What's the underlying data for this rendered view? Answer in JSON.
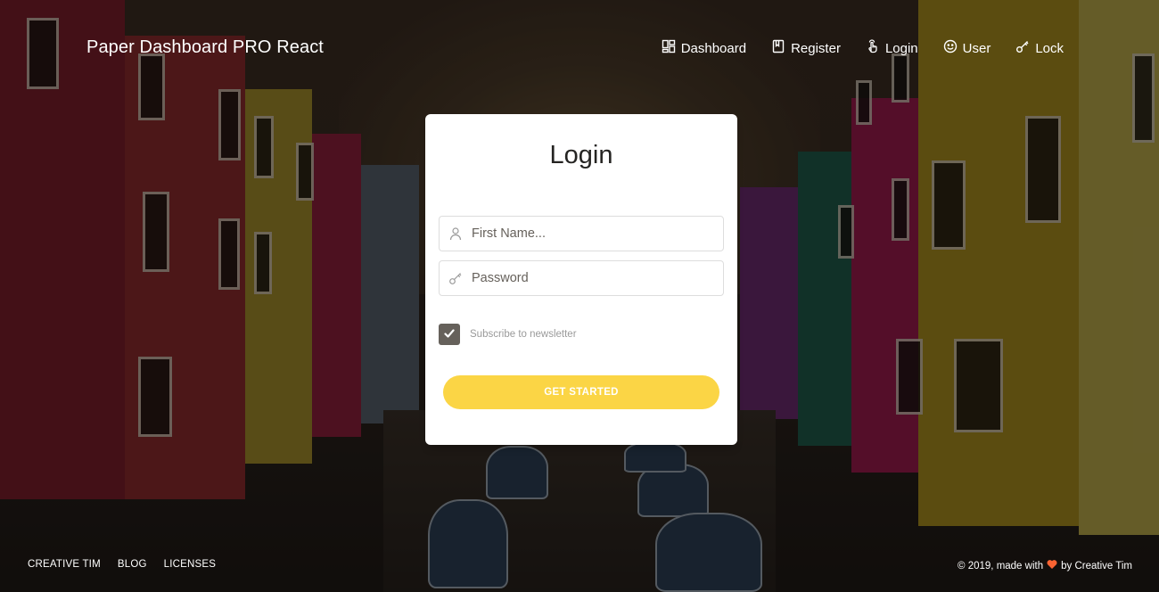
{
  "brand": {
    "title": "Paper Dashboard PRO React"
  },
  "nav": {
    "items": [
      {
        "label": "Dashboard",
        "icon": "layout-icon"
      },
      {
        "label": "Register",
        "icon": "book-icon"
      },
      {
        "label": "Login",
        "icon": "tap-hand-icon"
      },
      {
        "label": "User",
        "icon": "smiley-icon"
      },
      {
        "label": "Lock",
        "icon": "key-icon"
      }
    ]
  },
  "login": {
    "title": "Login",
    "first_name_placeholder": "First Name...",
    "password_placeholder": "Password",
    "newsletter_label": "Subscribe to newsletter",
    "newsletter_checked": true,
    "submit_label": "GET STARTED"
  },
  "footer": {
    "links": [
      "CREATIVE TIM",
      "BLOG",
      "LICENSES"
    ],
    "credit_prefix": "© 2019, made with",
    "credit_suffix": "by Creative Tim"
  },
  "colors": {
    "accent": "#fbd545",
    "card_bg": "#ffffff",
    "text_dark": "#252422",
    "checkbox": "#66615b",
    "heart": "#f96332"
  }
}
